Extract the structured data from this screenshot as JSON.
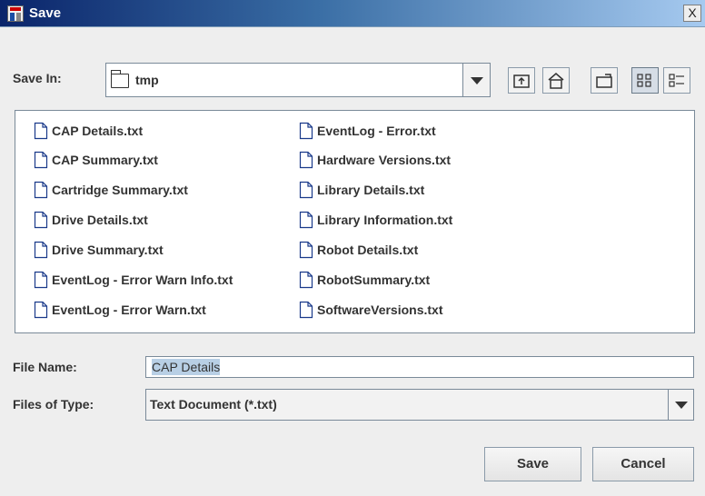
{
  "window": {
    "title": "Save",
    "close_label": "X"
  },
  "toolbar": {
    "save_in_label": "Save In:",
    "save_in_mnemonic": "I",
    "current_folder": "tmp",
    "buttons": [
      {
        "name": "up-one-level-button",
        "icon": "up-folder-icon"
      },
      {
        "name": "home-button",
        "icon": "home-icon"
      },
      {
        "name": "new-folder-button",
        "icon": "new-folder-icon"
      },
      {
        "name": "list-view-button",
        "icon": "list-view-icon"
      },
      {
        "name": "details-view-button",
        "icon": "details-view-icon"
      }
    ]
  },
  "files": {
    "column1": [
      "CAP Details.txt",
      "CAP Summary.txt",
      "Cartridge Summary.txt",
      "Drive Details.txt",
      "Drive Summary.txt",
      "EventLog - Error Warn Info.txt",
      "EventLog - Error Warn.txt"
    ],
    "column2": [
      "EventLog - Error.txt",
      "Hardware Versions.txt",
      "Library Details.txt",
      "Library Information.txt",
      "Robot Details.txt",
      "RobotSummary.txt",
      "SoftwareVersions.txt"
    ]
  },
  "form": {
    "file_name_label": "File Name:",
    "file_name_value": "CAP Details",
    "files_of_type_label": "Files of Type:",
    "files_of_type_value": "Text Document (*.txt)"
  },
  "actions": {
    "save_label": "Save",
    "cancel_label": "Cancel"
  }
}
